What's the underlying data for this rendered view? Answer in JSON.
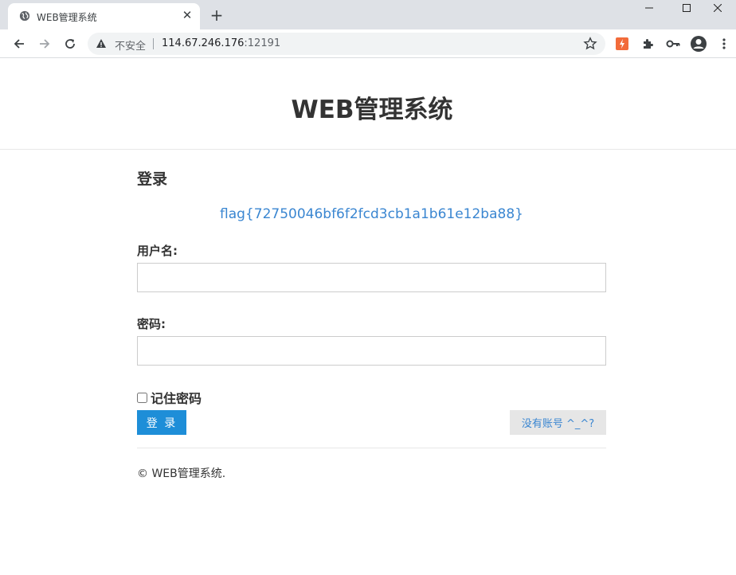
{
  "browser": {
    "tab_title": "WEB管理系统",
    "tab_close": "✕",
    "new_tab": "+",
    "security_label": "不安全",
    "url_host": "114.67.246.176",
    "url_port": ":12191"
  },
  "header": {
    "title": "WEB管理系统"
  },
  "login": {
    "heading": "登录",
    "flag": "flag{72750046bf6f2fcd3cb1a1b61e12ba88}",
    "username_label": "用户名:",
    "username_value": "",
    "password_label": "密码:",
    "password_value": "",
    "remember_label": "记住密码",
    "remember_checked": false,
    "login_button": "登 录",
    "register_button": "没有账号 ^_^?"
  },
  "footer": {
    "copyright": "© WEB管理系统."
  },
  "colors": {
    "accent": "#1e8ed8",
    "link": "#3a86d1",
    "extension": "#f26b3a"
  }
}
